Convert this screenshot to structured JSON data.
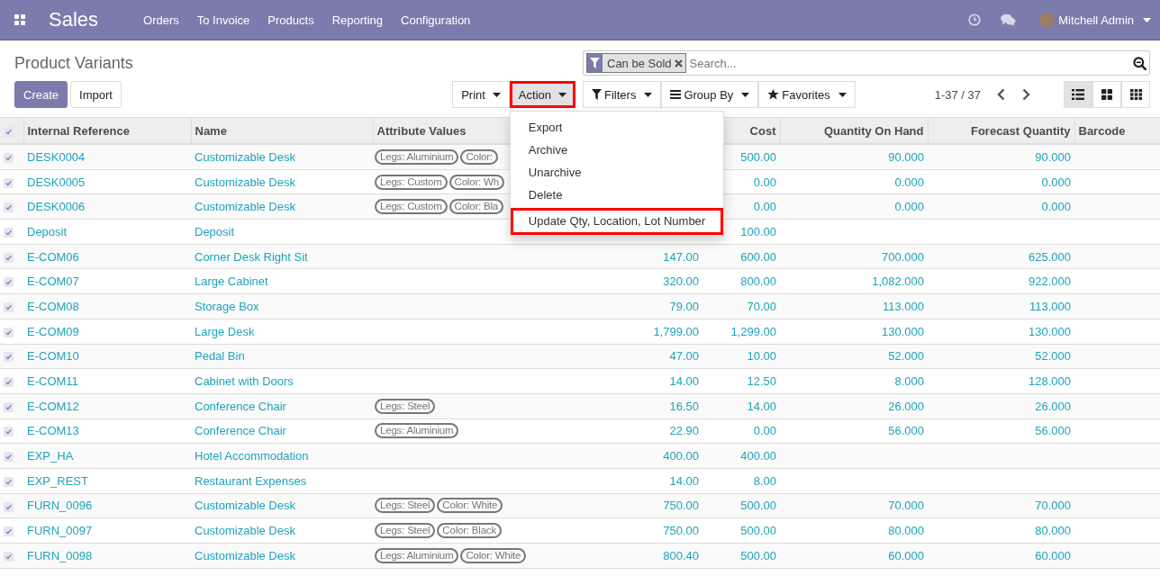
{
  "navbar": {
    "app_name": "Sales",
    "menu": [
      "Orders",
      "To Invoice",
      "Products",
      "Reporting",
      "Configuration"
    ],
    "user": "Mitchell Admin"
  },
  "control_panel": {
    "title": "Product Variants",
    "buttons": [
      {
        "label": "Create",
        "kind": "primary"
      },
      {
        "label": "Import",
        "kind": "secondary"
      }
    ],
    "dropdowns": [
      {
        "label": "Print",
        "open": false,
        "highlighted": false
      },
      {
        "label": "Action",
        "open": true,
        "highlighted": true
      }
    ],
    "action_menu": [
      {
        "label": "Export",
        "highlighted": false
      },
      {
        "label": "Archive",
        "highlighted": false
      },
      {
        "label": "Unarchive",
        "highlighted": false
      },
      {
        "label": "Delete",
        "highlighted": false
      },
      {
        "label": "Update Qty, Location, Lot Number",
        "highlighted": true
      }
    ],
    "search": {
      "facets": [
        "Can be Sold"
      ],
      "placeholder": "Search..."
    },
    "search_menus": [
      "Filters",
      "Group By",
      "Favorites"
    ],
    "pager": "1-37 / 37",
    "views": [
      {
        "kind": "list",
        "selected": true
      },
      {
        "kind": "kanban",
        "selected": false
      },
      {
        "kind": "grid",
        "selected": false
      }
    ]
  },
  "table": {
    "all_selected": true,
    "columns": [
      "Internal Reference",
      "Name",
      "Attribute Values",
      "Cost",
      "Quantity On Hand",
      "Forecast Quantity",
      "Barcode"
    ],
    "rows": [
      {
        "selected": true,
        "internal_reference": "DESK0004",
        "name": "Customizable Desk",
        "attribute_values": [
          "Legs: Aluminium",
          "Color:"
        ],
        "cost": "500.00",
        "quantity_on_hand": "90.000",
        "forecast_quantity": "90.000"
      },
      {
        "selected": true,
        "internal_reference": "DESK0005",
        "name": "Customizable Desk",
        "attribute_values": [
          "Legs: Custom",
          "Color: Wh"
        ],
        "cost": "0.00",
        "quantity_on_hand": "0.000",
        "forecast_quantity": "0.000"
      },
      {
        "selected": true,
        "internal_reference": "DESK0006",
        "name": "Customizable Desk",
        "attribute_values": [
          "Legs: Custom",
          "Color: Bla"
        ],
        "cost": "0.00",
        "quantity_on_hand": "0.000",
        "forecast_quantity": "0.000"
      },
      {
        "selected": true,
        "internal_reference": "Deposit",
        "name": "Deposit",
        "attribute_values": [],
        "cost": "100.00"
      },
      {
        "selected": true,
        "internal_reference": "E-COM06",
        "name": "Corner Desk Right Sit",
        "attribute_values": [],
        "sales_price": "147.00",
        "cost": "600.00",
        "quantity_on_hand": "700.000",
        "forecast_quantity": "625.000"
      },
      {
        "selected": true,
        "internal_reference": "E-COM07",
        "name": "Large Cabinet",
        "attribute_values": [],
        "sales_price": "320.00",
        "cost": "800.00",
        "quantity_on_hand": "1,082.000",
        "forecast_quantity": "922.000"
      },
      {
        "selected": true,
        "internal_reference": "E-COM08",
        "name": "Storage Box",
        "attribute_values": [],
        "sales_price": "79.00",
        "cost": "70.00",
        "quantity_on_hand": "113.000",
        "forecast_quantity": "113.000"
      },
      {
        "selected": true,
        "internal_reference": "E-COM09",
        "name": "Large Desk",
        "attribute_values": [],
        "sales_price": "1,799.00",
        "cost": "1,299.00",
        "quantity_on_hand": "130.000",
        "forecast_quantity": "130.000"
      },
      {
        "selected": true,
        "internal_reference": "E-COM10",
        "name": "Pedal Bin",
        "attribute_values": [],
        "sales_price": "47.00",
        "cost": "10.00",
        "quantity_on_hand": "52.000",
        "forecast_quantity": "52.000"
      },
      {
        "selected": true,
        "internal_reference": "E-COM11",
        "name": "Cabinet with Doors",
        "attribute_values": [],
        "sales_price": "14.00",
        "cost": "12.50",
        "quantity_on_hand": "8.000",
        "forecast_quantity": "128.000"
      },
      {
        "selected": true,
        "internal_reference": "E-COM12",
        "name": "Conference Chair",
        "attribute_values": [
          "Legs: Steel"
        ],
        "sales_price": "16.50",
        "cost": "14.00",
        "quantity_on_hand": "26.000",
        "forecast_quantity": "26.000"
      },
      {
        "selected": true,
        "internal_reference": "E-COM13",
        "name": "Conference Chair",
        "attribute_values": [
          "Legs: Aluminium"
        ],
        "sales_price": "22.90",
        "cost": "0.00",
        "quantity_on_hand": "56.000",
        "forecast_quantity": "56.000"
      },
      {
        "selected": true,
        "internal_reference": "EXP_HA",
        "name": "Hotel Accommodation",
        "attribute_values": [],
        "sales_price": "400.00",
        "cost": "400.00"
      },
      {
        "selected": true,
        "internal_reference": "EXP_REST",
        "name": "Restaurant Expenses",
        "attribute_values": [],
        "sales_price": "14.00",
        "cost": "8.00"
      },
      {
        "selected": true,
        "internal_reference": "FURN_0096",
        "name": "Customizable Desk",
        "attribute_values": [
          "Legs: Steel",
          "Color: White"
        ],
        "sales_price": "750.00",
        "cost": "500.00",
        "quantity_on_hand": "70.000",
        "forecast_quantity": "70.000"
      },
      {
        "selected": true,
        "internal_reference": "FURN_0097",
        "name": "Customizable Desk",
        "attribute_values": [
          "Legs: Steel",
          "Color: Black"
        ],
        "sales_price": "750.00",
        "cost": "500.00",
        "quantity_on_hand": "80.000",
        "forecast_quantity": "80.000"
      },
      {
        "selected": true,
        "internal_reference": "FURN_0098",
        "name": "Customizable Desk",
        "attribute_values": [
          "Legs: Aluminium",
          "Color: White"
        ],
        "sales_price": "800.40",
        "cost": "500.00",
        "quantity_on_hand": "60.000",
        "forecast_quantity": "60.000"
      }
    ]
  }
}
